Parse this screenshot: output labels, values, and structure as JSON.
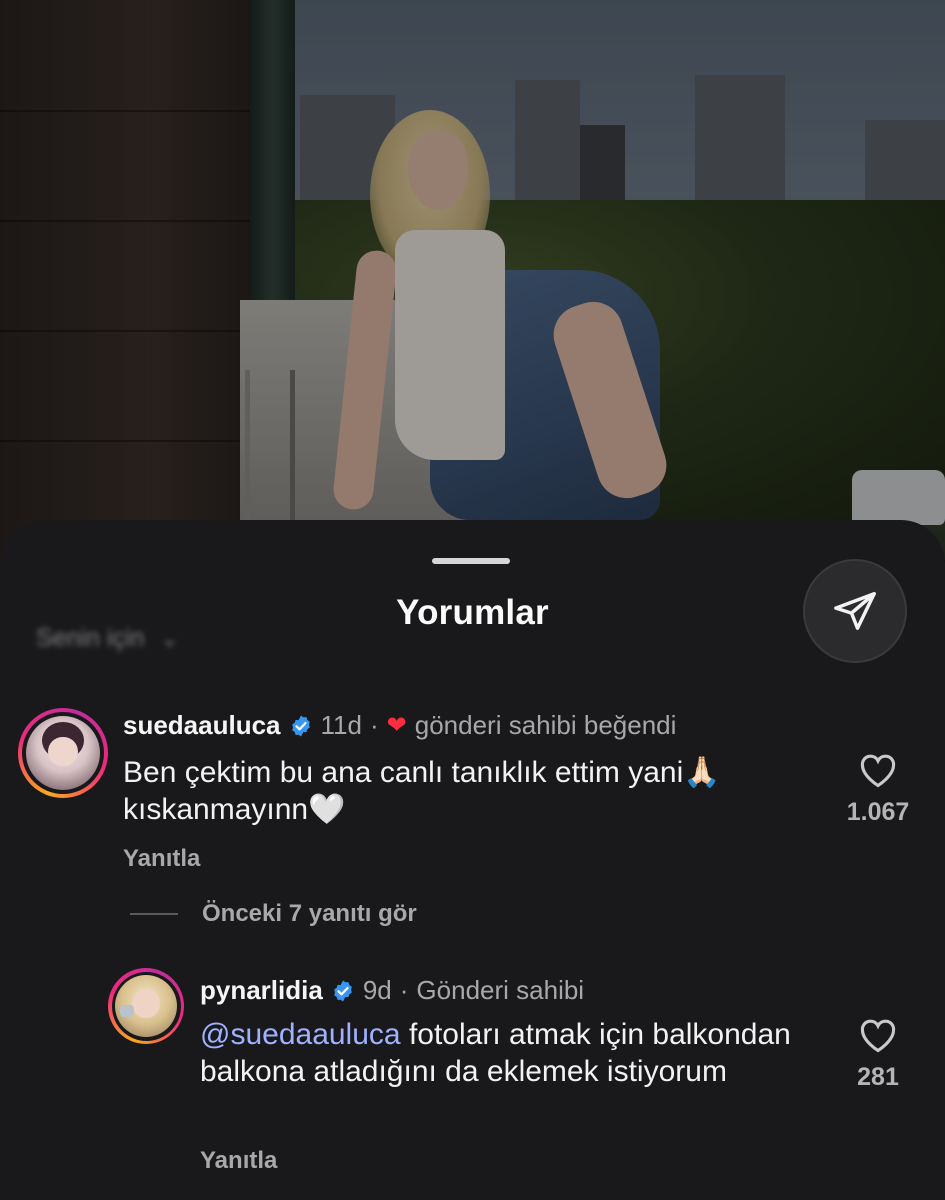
{
  "sheet": {
    "title": "Yorumlar",
    "filter_label": "Senin için"
  },
  "comments": [
    {
      "username": "suedaauluca",
      "time": "11d",
      "separator": "·",
      "meta": "gönderi sahibi beğendi",
      "text": "Ben çektim bu ana canlı tanıklık ettim yani🙏🏻 kıskanmayınn🤍",
      "likes": "1.067",
      "reply_label": "Yanıtla"
    }
  ],
  "view_replies_label": "Önceki 7 yanıtı gör",
  "replies": [
    {
      "username": "pynarlidia",
      "time": "9d",
      "separator": "·",
      "meta": "Gönderi sahibi",
      "mention": "@suedaauluca",
      "text": "fotoları atmak için balkondan balkona atladığını da eklemek istiyorum",
      "likes": "281",
      "reply_label": "Yanıtla"
    }
  ],
  "colors": {
    "sheet_bg": "#19191b",
    "accent_link": "#9fb1ff",
    "verified": "#3797f0",
    "like_heart": "#ff2d3f"
  },
  "icons": [
    "send-icon",
    "verified-badge-icon",
    "heart-icon",
    "small-heart-icon",
    "chevron-down-icon"
  ]
}
